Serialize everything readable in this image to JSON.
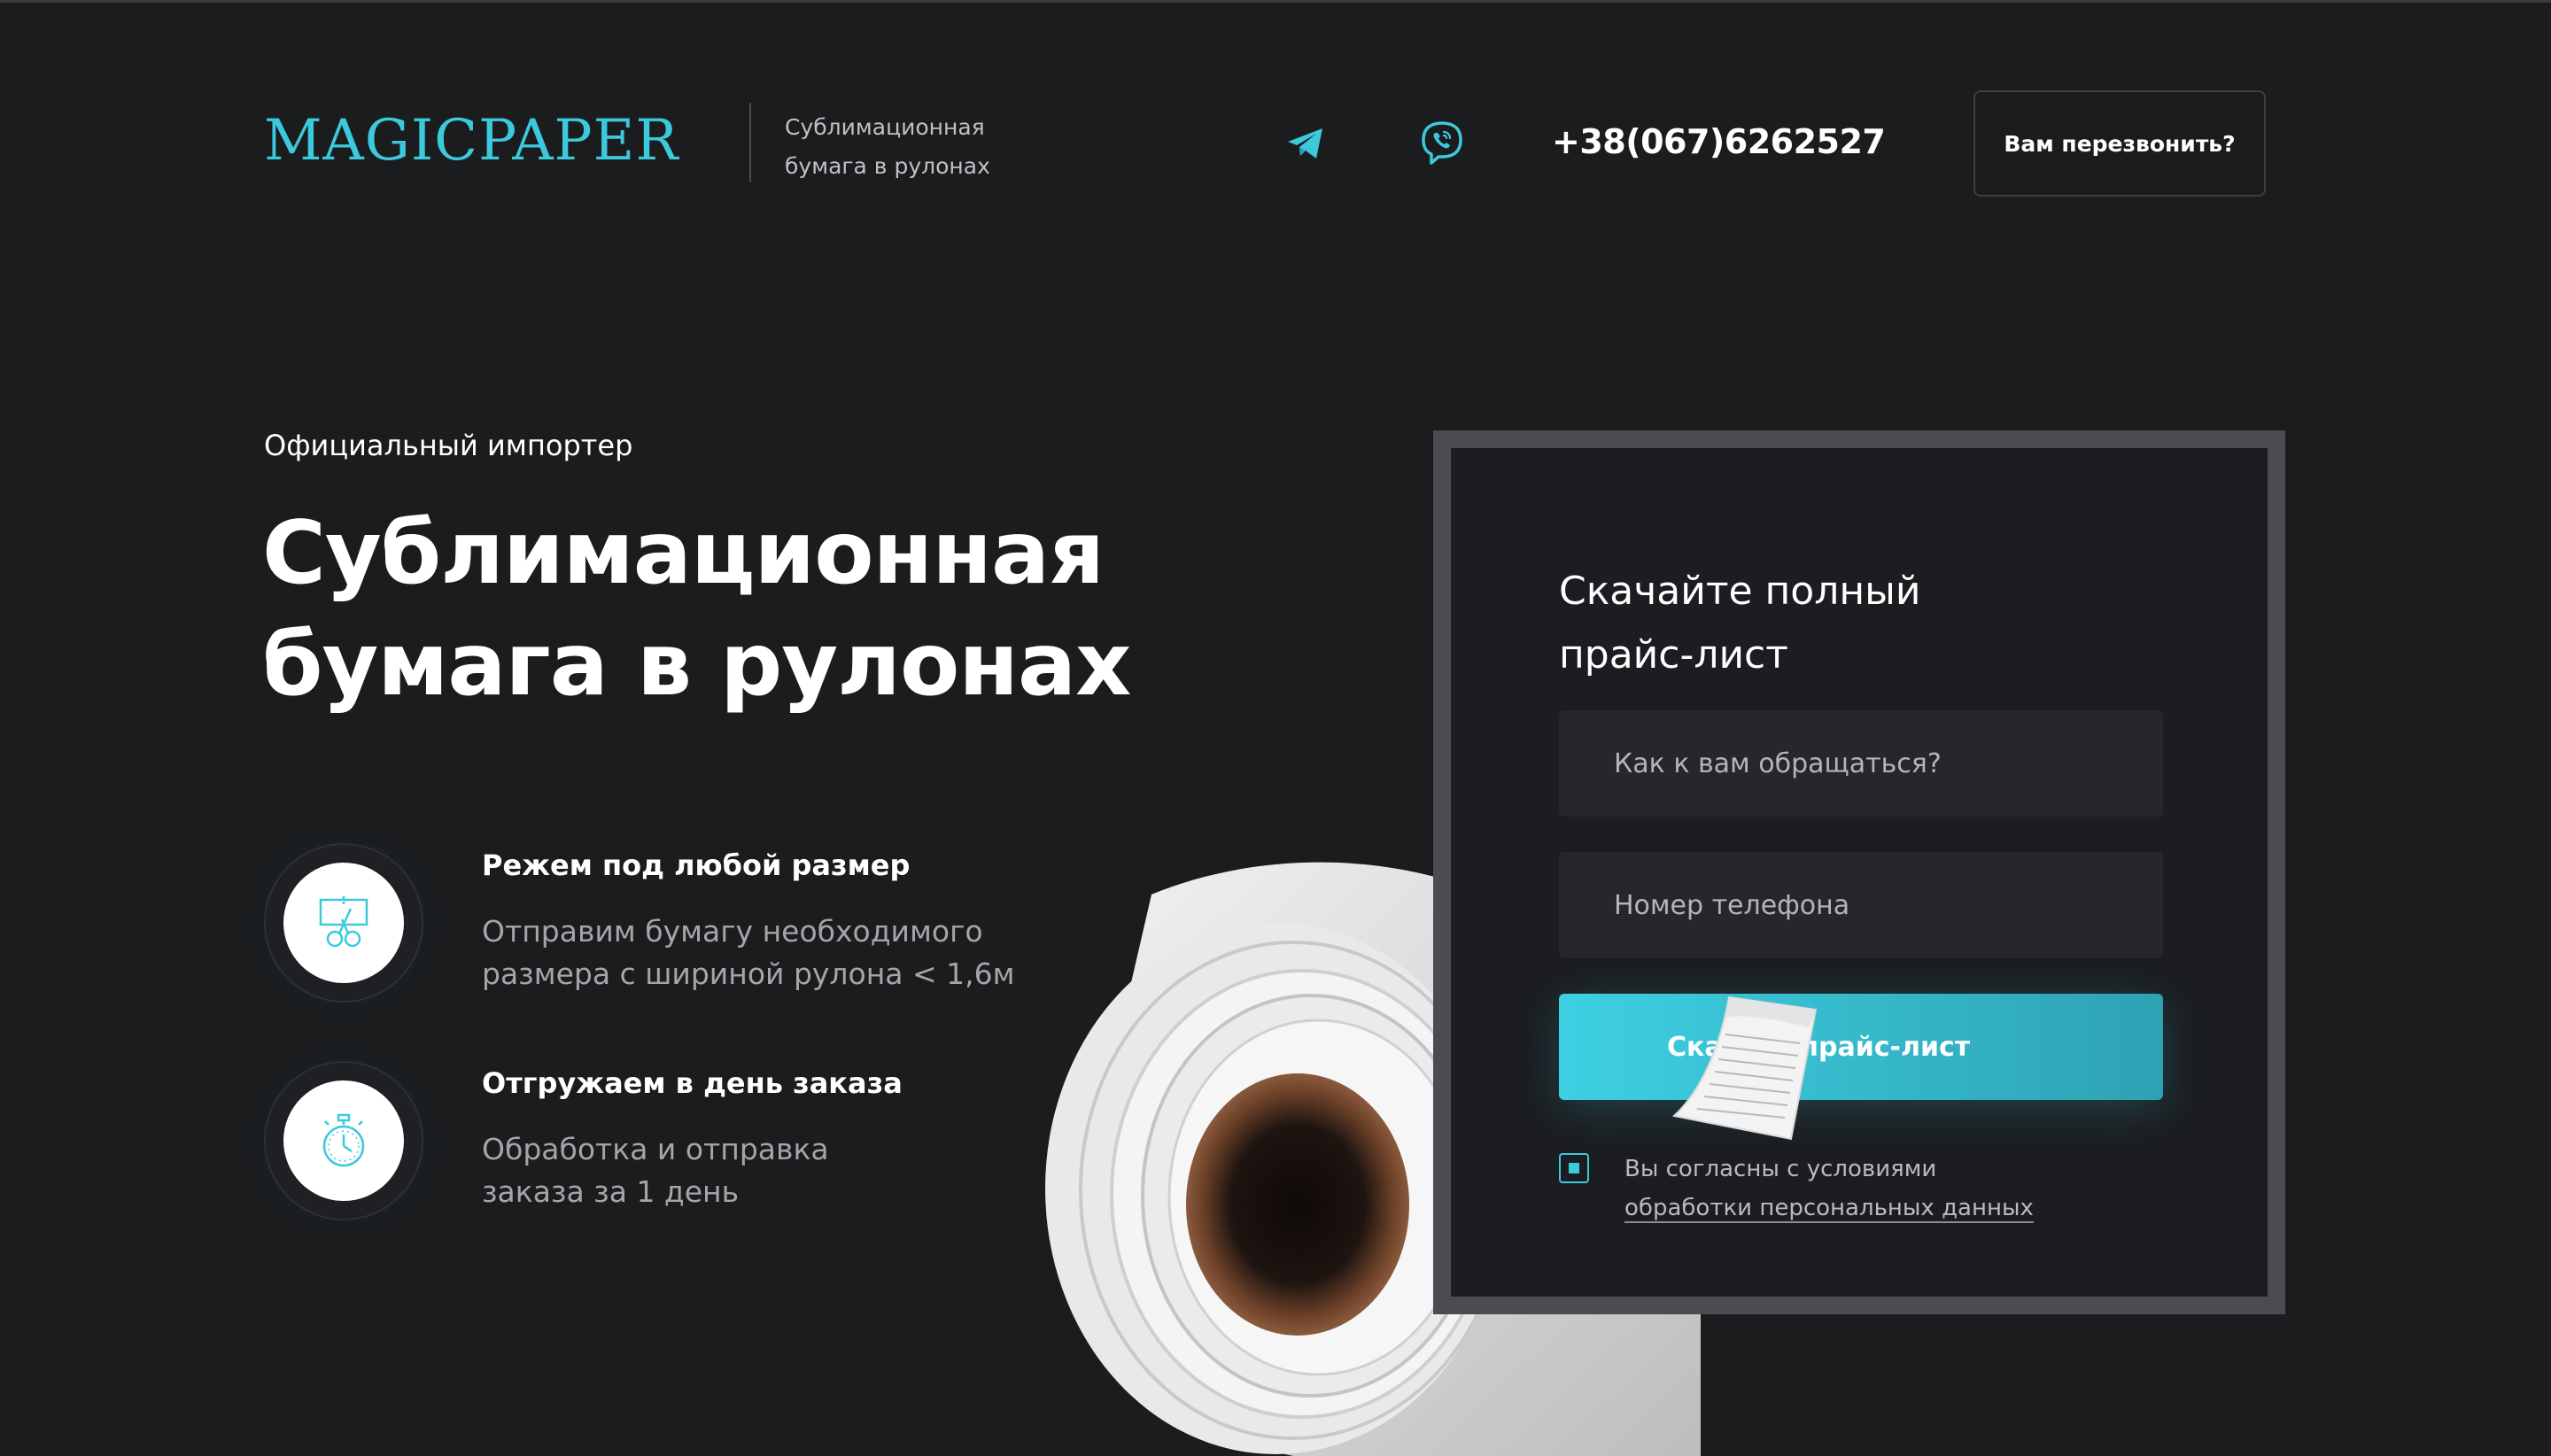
{
  "header": {
    "logo": "MAGICPAPER",
    "tagline_line1": "Сублимационная",
    "tagline_line2": "бумага в рулонах",
    "telegram_icon": "telegram-icon",
    "viber_icon": "viber-icon",
    "phone": "+38(067)6262527",
    "callback_label": "Вам перезвонить?"
  },
  "hero": {
    "eyebrow": "Официальный импортер",
    "title_line1": "Сублимационная",
    "title_line2": "бумага в рулонах"
  },
  "features": [
    {
      "icon": "scissors-cut-icon",
      "title": "Режем под любой размер",
      "text_line1": "Отправим бумагу необходимого",
      "text_line2": "размера с шириной рулона < 1,6м"
    },
    {
      "icon": "stopwatch-icon",
      "title": "Отгружаем в день заказа",
      "text_line1": "Обработка и отправка",
      "text_line2": "заказа за 1 день"
    }
  ],
  "form": {
    "title_line1": "Скачайте полный",
    "title_line2": "прайс-лист",
    "name_placeholder": "Как к вам обращаться?",
    "phone_placeholder": "Номер телефона",
    "submit_label": "Скачать прайс-лист",
    "consent_text": "Вы согласны с условиями",
    "consent_link": "обработки персональных данных",
    "consent_checked": true
  },
  "colors": {
    "background": "#1b1c1e",
    "accent": "#3cc9dc",
    "panel": "#1c1d20",
    "frame": "#4a4c51"
  }
}
